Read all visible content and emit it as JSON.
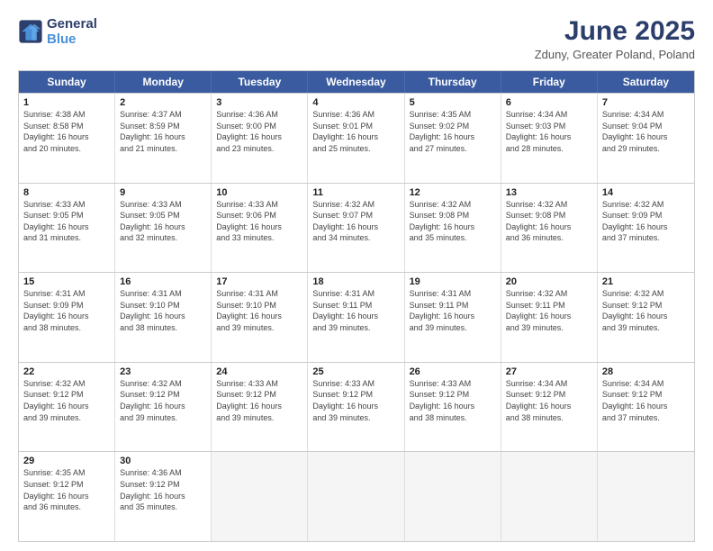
{
  "header": {
    "logo_line1": "General",
    "logo_line2": "Blue",
    "title": "June 2025",
    "subtitle": "Zduny, Greater Poland, Poland"
  },
  "weekdays": [
    "Sunday",
    "Monday",
    "Tuesday",
    "Wednesday",
    "Thursday",
    "Friday",
    "Saturday"
  ],
  "weeks": [
    [
      {
        "day": "1",
        "info": "Sunrise: 4:38 AM\nSunset: 8:58 PM\nDaylight: 16 hours\nand 20 minutes."
      },
      {
        "day": "2",
        "info": "Sunrise: 4:37 AM\nSunset: 8:59 PM\nDaylight: 16 hours\nand 21 minutes."
      },
      {
        "day": "3",
        "info": "Sunrise: 4:36 AM\nSunset: 9:00 PM\nDaylight: 16 hours\nand 23 minutes."
      },
      {
        "day": "4",
        "info": "Sunrise: 4:36 AM\nSunset: 9:01 PM\nDaylight: 16 hours\nand 25 minutes."
      },
      {
        "day": "5",
        "info": "Sunrise: 4:35 AM\nSunset: 9:02 PM\nDaylight: 16 hours\nand 27 minutes."
      },
      {
        "day": "6",
        "info": "Sunrise: 4:34 AM\nSunset: 9:03 PM\nDaylight: 16 hours\nand 28 minutes."
      },
      {
        "day": "7",
        "info": "Sunrise: 4:34 AM\nSunset: 9:04 PM\nDaylight: 16 hours\nand 29 minutes."
      }
    ],
    [
      {
        "day": "8",
        "info": "Sunrise: 4:33 AM\nSunset: 9:05 PM\nDaylight: 16 hours\nand 31 minutes."
      },
      {
        "day": "9",
        "info": "Sunrise: 4:33 AM\nSunset: 9:05 PM\nDaylight: 16 hours\nand 32 minutes."
      },
      {
        "day": "10",
        "info": "Sunrise: 4:33 AM\nSunset: 9:06 PM\nDaylight: 16 hours\nand 33 minutes."
      },
      {
        "day": "11",
        "info": "Sunrise: 4:32 AM\nSunset: 9:07 PM\nDaylight: 16 hours\nand 34 minutes."
      },
      {
        "day": "12",
        "info": "Sunrise: 4:32 AM\nSunset: 9:08 PM\nDaylight: 16 hours\nand 35 minutes."
      },
      {
        "day": "13",
        "info": "Sunrise: 4:32 AM\nSunset: 9:08 PM\nDaylight: 16 hours\nand 36 minutes."
      },
      {
        "day": "14",
        "info": "Sunrise: 4:32 AM\nSunset: 9:09 PM\nDaylight: 16 hours\nand 37 minutes."
      }
    ],
    [
      {
        "day": "15",
        "info": "Sunrise: 4:31 AM\nSunset: 9:09 PM\nDaylight: 16 hours\nand 38 minutes."
      },
      {
        "day": "16",
        "info": "Sunrise: 4:31 AM\nSunset: 9:10 PM\nDaylight: 16 hours\nand 38 minutes."
      },
      {
        "day": "17",
        "info": "Sunrise: 4:31 AM\nSunset: 9:10 PM\nDaylight: 16 hours\nand 39 minutes."
      },
      {
        "day": "18",
        "info": "Sunrise: 4:31 AM\nSunset: 9:11 PM\nDaylight: 16 hours\nand 39 minutes."
      },
      {
        "day": "19",
        "info": "Sunrise: 4:31 AM\nSunset: 9:11 PM\nDaylight: 16 hours\nand 39 minutes."
      },
      {
        "day": "20",
        "info": "Sunrise: 4:32 AM\nSunset: 9:11 PM\nDaylight: 16 hours\nand 39 minutes."
      },
      {
        "day": "21",
        "info": "Sunrise: 4:32 AM\nSunset: 9:12 PM\nDaylight: 16 hours\nand 39 minutes."
      }
    ],
    [
      {
        "day": "22",
        "info": "Sunrise: 4:32 AM\nSunset: 9:12 PM\nDaylight: 16 hours\nand 39 minutes."
      },
      {
        "day": "23",
        "info": "Sunrise: 4:32 AM\nSunset: 9:12 PM\nDaylight: 16 hours\nand 39 minutes."
      },
      {
        "day": "24",
        "info": "Sunrise: 4:33 AM\nSunset: 9:12 PM\nDaylight: 16 hours\nand 39 minutes."
      },
      {
        "day": "25",
        "info": "Sunrise: 4:33 AM\nSunset: 9:12 PM\nDaylight: 16 hours\nand 39 minutes."
      },
      {
        "day": "26",
        "info": "Sunrise: 4:33 AM\nSunset: 9:12 PM\nDaylight: 16 hours\nand 38 minutes."
      },
      {
        "day": "27",
        "info": "Sunrise: 4:34 AM\nSunset: 9:12 PM\nDaylight: 16 hours\nand 38 minutes."
      },
      {
        "day": "28",
        "info": "Sunrise: 4:34 AM\nSunset: 9:12 PM\nDaylight: 16 hours\nand 37 minutes."
      }
    ],
    [
      {
        "day": "29",
        "info": "Sunrise: 4:35 AM\nSunset: 9:12 PM\nDaylight: 16 hours\nand 36 minutes."
      },
      {
        "day": "30",
        "info": "Sunrise: 4:36 AM\nSunset: 9:12 PM\nDaylight: 16 hours\nand 35 minutes."
      },
      {
        "day": "",
        "info": ""
      },
      {
        "day": "",
        "info": ""
      },
      {
        "day": "",
        "info": ""
      },
      {
        "day": "",
        "info": ""
      },
      {
        "day": "",
        "info": ""
      }
    ]
  ]
}
